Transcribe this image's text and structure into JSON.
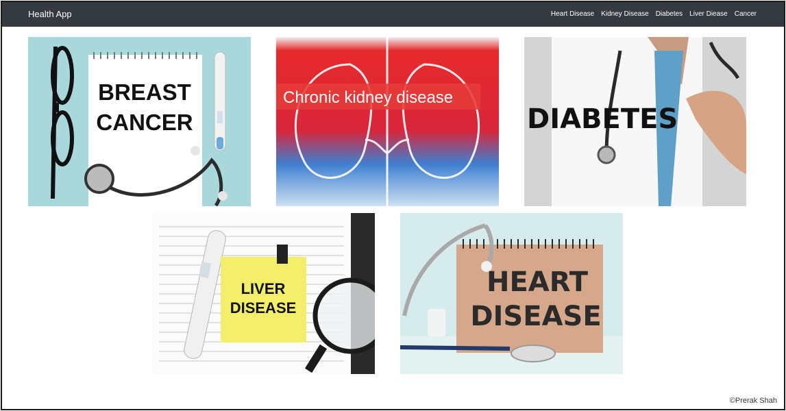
{
  "navbar": {
    "brand": "Health App",
    "links": [
      "Heart Disease",
      "Kidney Disease",
      "Diabetes",
      "Liver Diease",
      "Cancer"
    ]
  },
  "cards": {
    "breast": {
      "line1": "BREAST",
      "line2": "CANCER"
    },
    "kidney": {
      "caption": "Chronic kidney disease"
    },
    "diabetes": {
      "word": "DIABETES"
    },
    "liver": {
      "line1": "LIVER",
      "line2": "DISEASE"
    },
    "heart": {
      "line1": "HEART",
      "line2": "DISEASE"
    }
  },
  "footer": {
    "copyright": "©Prerak Shah"
  },
  "colors": {
    "navbar_bg": "#343a40",
    "navbar_text": "#ffffff",
    "breast_bg": "#a9d8dc",
    "kidney_red": "#e0282a",
    "kidney_blue": "#3f7fd0",
    "liver_note": "#f4ef6a",
    "heart_card": "#d5a88c"
  }
}
